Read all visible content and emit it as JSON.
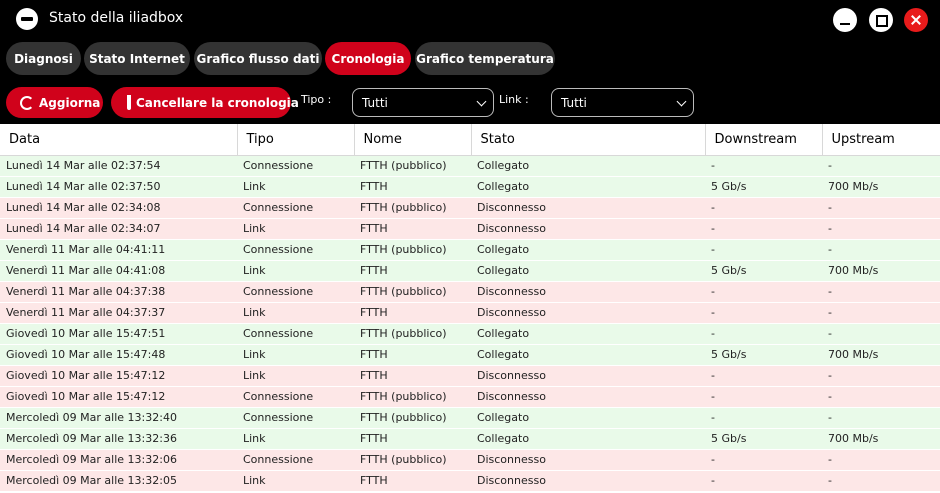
{
  "window": {
    "title": "Stato della iliadbox"
  },
  "tabs": [
    {
      "label": "Diagnosi",
      "active": false
    },
    {
      "label": "Stato Internet",
      "active": false
    },
    {
      "label": "Grafico flusso dati",
      "active": false
    },
    {
      "label": "Cronologia",
      "active": true
    },
    {
      "label": "Grafico temperatura",
      "active": false
    }
  ],
  "toolbar": {
    "refresh_label": "Aggiorna",
    "clear_label": "Cancellare la cronologia",
    "tipo_label": "Tipo :",
    "tipo_value": "Tutti",
    "link_label": "Link :",
    "link_value": "Tutti"
  },
  "colors": {
    "accent": "#d0021b",
    "row_ok": "#e9fae9",
    "row_ko": "#fde7e7"
  },
  "table": {
    "columns": [
      "Data",
      "Tipo",
      "Nome",
      "Stato",
      "Downstream",
      "Upstream"
    ],
    "rows": [
      [
        "Lunedì 14 Mar alle 02:37:54",
        "Connessione",
        "FTTH (pubblico)",
        "Collegato",
        "-",
        "-"
      ],
      [
        "Lunedì 14 Mar alle 02:37:50",
        "Link",
        "FTTH",
        "Collegato",
        "5 Gb/s",
        "700 Mb/s"
      ],
      [
        "Lunedì 14 Mar alle 02:34:08",
        "Connessione",
        "FTTH (pubblico)",
        "Disconnesso",
        "-",
        "-"
      ],
      [
        "Lunedì 14 Mar alle 02:34:07",
        "Link",
        "FTTH",
        "Disconnesso",
        "-",
        "-"
      ],
      [
        "Venerdì 11 Mar alle 04:41:11",
        "Connessione",
        "FTTH (pubblico)",
        "Collegato",
        "-",
        "-"
      ],
      [
        "Venerdì 11 Mar alle 04:41:08",
        "Link",
        "FTTH",
        "Collegato",
        "5 Gb/s",
        "700 Mb/s"
      ],
      [
        "Venerdì 11 Mar alle 04:37:38",
        "Connessione",
        "FTTH (pubblico)",
        "Disconnesso",
        "-",
        "-"
      ],
      [
        "Venerdì 11 Mar alle 04:37:37",
        "Link",
        "FTTH",
        "Disconnesso",
        "-",
        "-"
      ],
      [
        "Giovedì 10 Mar alle 15:47:51",
        "Connessione",
        "FTTH (pubblico)",
        "Collegato",
        "-",
        "-"
      ],
      [
        "Giovedì 10 Mar alle 15:47:48",
        "Link",
        "FTTH",
        "Collegato",
        "5 Gb/s",
        "700 Mb/s"
      ],
      [
        "Giovedì 10 Mar alle 15:47:12",
        "Link",
        "FTTH",
        "Disconnesso",
        "-",
        "-"
      ],
      [
        "Giovedì 10 Mar alle 15:47:12",
        "Connessione",
        "FTTH (pubblico)",
        "Disconnesso",
        "-",
        "-"
      ],
      [
        "Mercoledì 09 Mar alle 13:32:40",
        "Connessione",
        "FTTH (pubblico)",
        "Collegato",
        "-",
        "-"
      ],
      [
        "Mercoledì 09 Mar alle 13:32:36",
        "Link",
        "FTTH",
        "Collegato",
        "5 Gb/s",
        "700 Mb/s"
      ],
      [
        "Mercoledì 09 Mar alle 13:32:06",
        "Connessione",
        "FTTH (pubblico)",
        "Disconnesso",
        "-",
        "-"
      ],
      [
        "Mercoledì 09 Mar alle 13:32:05",
        "Link",
        "FTTH",
        "Disconnesso",
        "-",
        "-"
      ]
    ]
  }
}
